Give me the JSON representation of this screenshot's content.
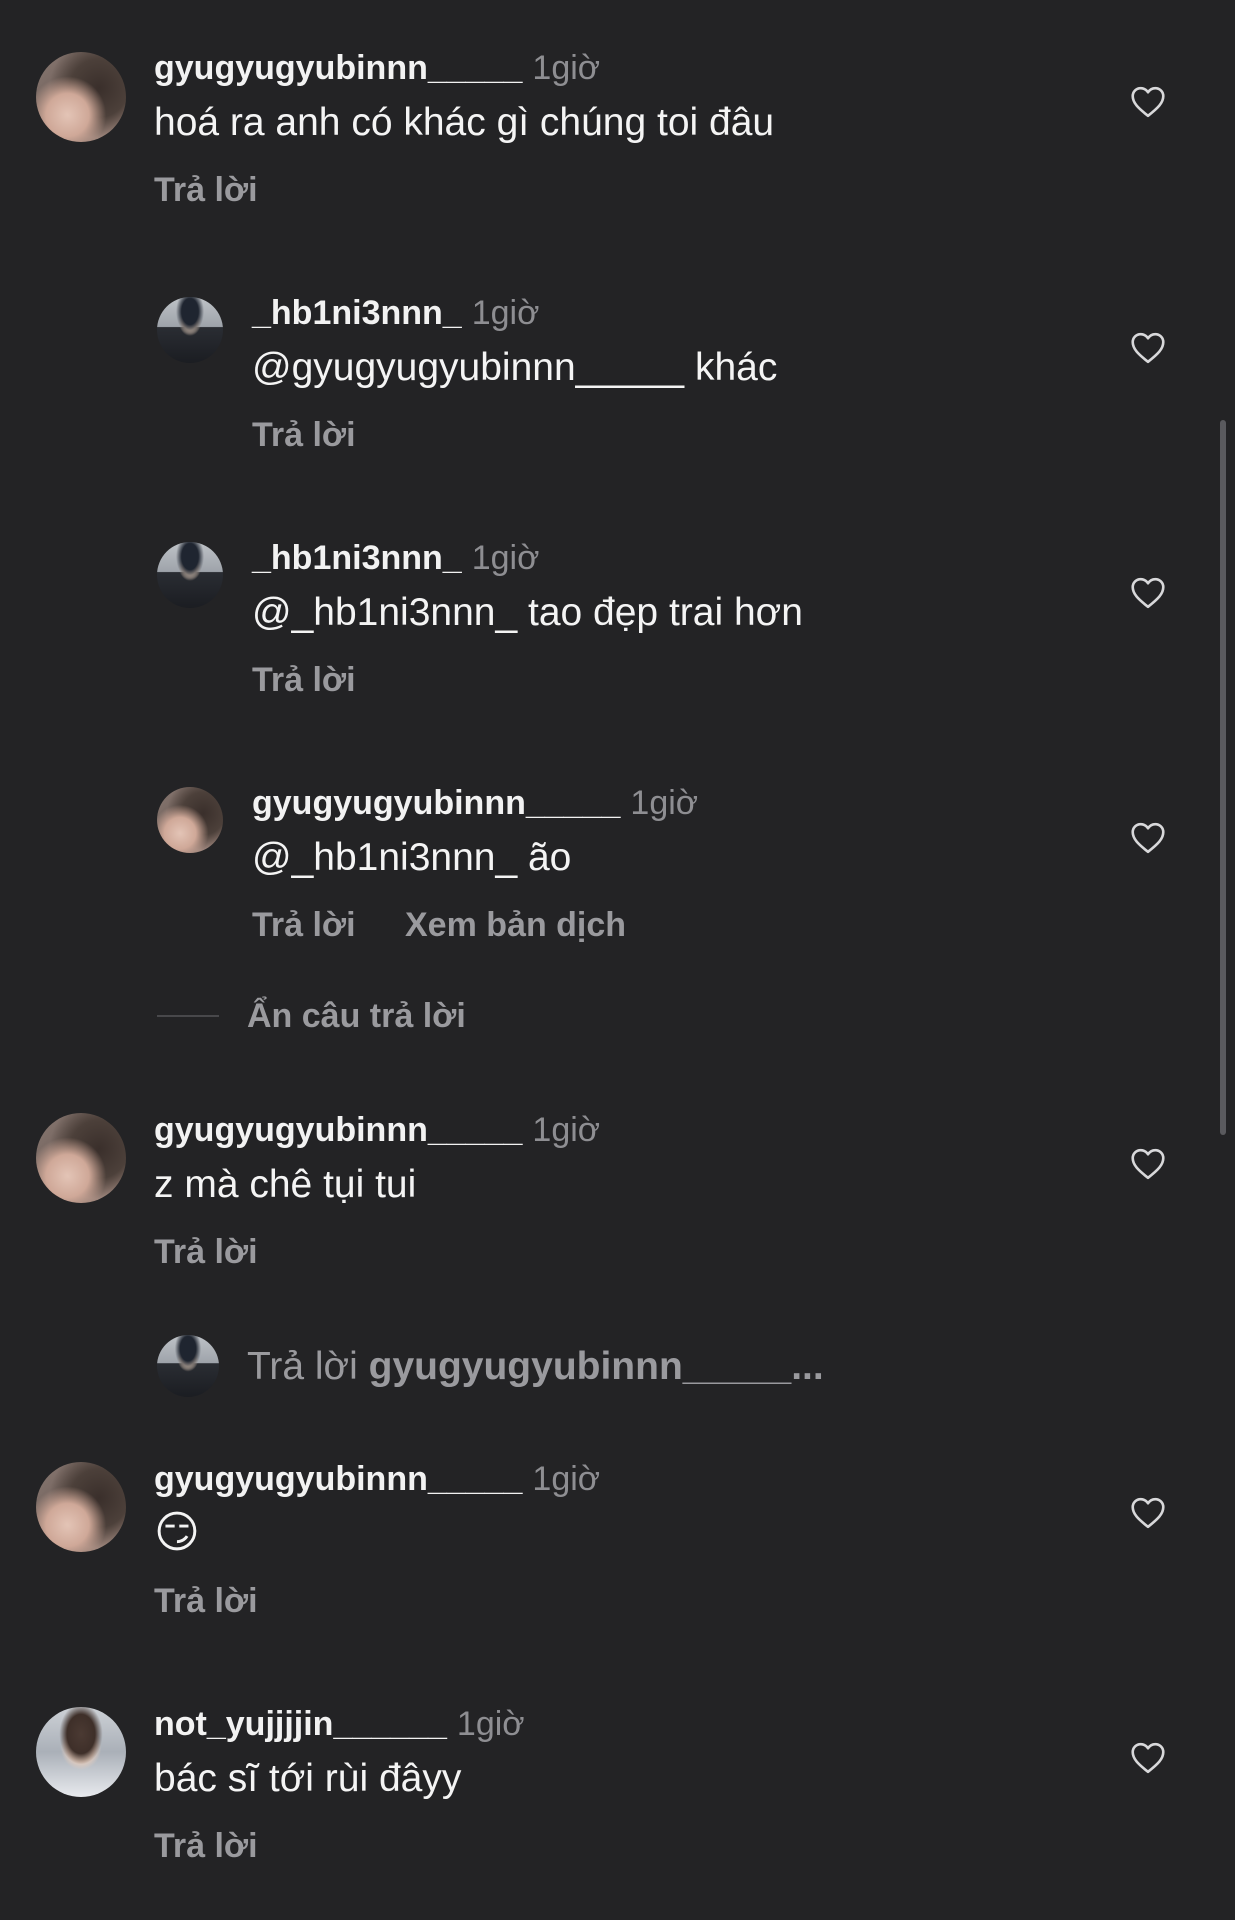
{
  "comments": [
    {
      "username": "gyugyugyubinnn_____",
      "time": "1giờ",
      "text": "hoá ra anh có khác gì chúng toi đâu",
      "reply_label": "Trả lời"
    },
    {
      "username": "_hb1ni3nnn_",
      "time": "1giờ",
      "text": "@gyugyugyubinnn_____ khác",
      "reply_label": "Trả lời"
    },
    {
      "username": "_hb1ni3nnn_",
      "time": "1giờ",
      "text": "@_hb1ni3nnn_ tao đẹp trai hơn",
      "reply_label": "Trả lời"
    },
    {
      "username": "gyugyugyubinnn_____",
      "time": "1giờ",
      "text": "@_hb1ni3nnn_ ão",
      "reply_label": "Trả lời",
      "translate_label": "Xem bản dịch"
    },
    {
      "username": "gyugyugyubinnn_____",
      "time": "1giờ",
      "text": "z mà chê tụi tui",
      "reply_label": "Trả lời"
    },
    {
      "username": "gyugyugyubinnn_____",
      "time": "1giờ",
      "text": "😏",
      "reply_label": "Trả lời"
    },
    {
      "username": "not_yujjjjin______",
      "time": "1giờ",
      "text": "bác sĩ tới rùi đâyy",
      "reply_label": "Trả lời"
    }
  ],
  "hide_replies_label": "Ẩn câu trả lời",
  "reply_box": {
    "prefix": "Trả lời",
    "target": "gyugyugyubinnn_____..."
  },
  "icons": {
    "like": "heart-outline-icon"
  },
  "colors": {
    "background": "#232325",
    "text_primary": "#f2f2f2",
    "text_secondary": "#8e8e92"
  }
}
